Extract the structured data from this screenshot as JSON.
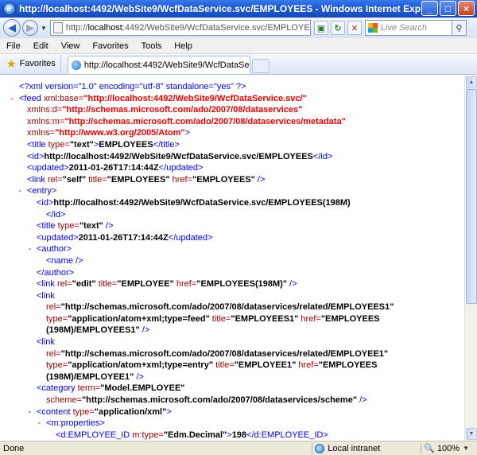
{
  "window": {
    "title": "http://localhost:4492/WebSite9/WcfDataService.svc/EMPLOYEES - Windows Internet Explorer",
    "minimize": "_",
    "maximize": "□",
    "close": "×"
  },
  "address": {
    "url_prefix": "http://",
    "url_host": "localhost",
    "url_path": ":4492/WebSite9/WcfDataService.svc/EMPLOYEES",
    "search_placeholder": "Live Search"
  },
  "menu": [
    "File",
    "Edit",
    "View",
    "Favorites",
    "Tools",
    "Help"
  ],
  "favorites": {
    "label": "Favorites",
    "tab_title": "http://localhost:4492/WebSite9/WcfDataService.svc/..."
  },
  "xml_lines": [
    {
      "indent": 24,
      "parts": [
        {
          "c": "pi",
          "t": "<?xml version=\"1.0\" encoding=\"utf-8\" standalone=\"yes\" ?>"
        }
      ]
    },
    {
      "indent": 24,
      "minus": true,
      "parts": [
        {
          "c": "tg",
          "t": "<feed "
        },
        {
          "c": "an",
          "t": "xml:base="
        },
        {
          "c": "ns",
          "t": "\"http://localhost:4492/WebSite9/WcfDataService.svc/\""
        }
      ]
    },
    {
      "indent": 34,
      "parts": [
        {
          "c": "an",
          "t": "xmlns:d="
        },
        {
          "c": "ns",
          "t": "\"http://schemas.microsoft.com/ado/2007/08/dataservices\""
        }
      ]
    },
    {
      "indent": 34,
      "parts": [
        {
          "c": "an",
          "t": "xmlns:m="
        },
        {
          "c": "ns",
          "t": "\"http://schemas.microsoft.com/ado/2007/08/dataservices/metadata\""
        }
      ]
    },
    {
      "indent": 34,
      "parts": [
        {
          "c": "an",
          "t": "xmlns="
        },
        {
          "c": "ns",
          "t": "\"http://www.w3.org/2005/Atom\""
        },
        {
          "c": "tg",
          "t": ">"
        }
      ]
    },
    {
      "indent": 34,
      "parts": [
        {
          "c": "tg",
          "t": "<title "
        },
        {
          "c": "an",
          "t": "type="
        },
        {
          "c": "av",
          "t": "\"text\""
        },
        {
          "c": "tg",
          "t": ">"
        },
        {
          "c": "tx",
          "t": "EMPLOYEES"
        },
        {
          "c": "tg",
          "t": "</title>"
        }
      ]
    },
    {
      "indent": 34,
      "parts": [
        {
          "c": "tg",
          "t": "<id>"
        },
        {
          "c": "tx",
          "t": "http://localhost:4492/WebSite9/WcfDataService.svc/EMPLOYEES"
        },
        {
          "c": "tg",
          "t": "</id>"
        }
      ]
    },
    {
      "indent": 34,
      "parts": [
        {
          "c": "tg",
          "t": "<updated>"
        },
        {
          "c": "tx",
          "t": "2011-01-26T17:14:44Z"
        },
        {
          "c": "tg",
          "t": "</updated>"
        }
      ]
    },
    {
      "indent": 34,
      "parts": [
        {
          "c": "tg",
          "t": "<link "
        },
        {
          "c": "an",
          "t": "rel="
        },
        {
          "c": "av",
          "t": "\"self\""
        },
        {
          "c": "an",
          "t": " title="
        },
        {
          "c": "av",
          "t": "\"EMPLOYEES\""
        },
        {
          "c": "an",
          "t": " href="
        },
        {
          "c": "av",
          "t": "\"EMPLOYEES\""
        },
        {
          "c": "tg",
          "t": " />"
        }
      ]
    },
    {
      "indent": 34,
      "minus": true,
      "parts": [
        {
          "c": "tg",
          "t": "<entry>"
        }
      ]
    },
    {
      "indent": 46,
      "parts": [
        {
          "c": "tg",
          "t": "<id>"
        },
        {
          "c": "tx",
          "t": "http://localhost:4492/WebSite9/WcfDataService.svc/EMPLOYEES(198M)"
        }
      ]
    },
    {
      "indent": 58,
      "parts": [
        {
          "c": "tg",
          "t": "</id>"
        }
      ]
    },
    {
      "indent": 46,
      "parts": [
        {
          "c": "tg",
          "t": "<title "
        },
        {
          "c": "an",
          "t": "type="
        },
        {
          "c": "av",
          "t": "\"text\""
        },
        {
          "c": "tg",
          "t": " />"
        }
      ]
    },
    {
      "indent": 46,
      "parts": [
        {
          "c": "tg",
          "t": "<updated>"
        },
        {
          "c": "tx",
          "t": "2011-01-26T17:14:44Z"
        },
        {
          "c": "tg",
          "t": "</updated>"
        }
      ]
    },
    {
      "indent": 46,
      "minus": true,
      "parts": [
        {
          "c": "tg",
          "t": "<author>"
        }
      ]
    },
    {
      "indent": 58,
      "parts": [
        {
          "c": "tg",
          "t": "<name />"
        }
      ]
    },
    {
      "indent": 46,
      "parts": [
        {
          "c": "tg",
          "t": "</author>"
        }
      ]
    },
    {
      "indent": 46,
      "parts": [
        {
          "c": "tg",
          "t": "<link "
        },
        {
          "c": "an",
          "t": "rel="
        },
        {
          "c": "av",
          "t": "\"edit\""
        },
        {
          "c": "an",
          "t": " title="
        },
        {
          "c": "av",
          "t": "\"EMPLOYEE\""
        },
        {
          "c": "an",
          "t": " href="
        },
        {
          "c": "av",
          "t": "\"EMPLOYEES(198M)\""
        },
        {
          "c": "tg",
          "t": " />"
        }
      ]
    },
    {
      "indent": 46,
      "parts": [
        {
          "c": "tg",
          "t": "<link"
        }
      ]
    },
    {
      "indent": 58,
      "parts": [
        {
          "c": "an",
          "t": "rel="
        },
        {
          "c": "av",
          "t": "\"http://schemas.microsoft.com/ado/2007/08/dataservices/related/EMPLOYEES1\""
        }
      ]
    },
    {
      "indent": 58,
      "parts": [
        {
          "c": "an",
          "t": "type="
        },
        {
          "c": "av",
          "t": "\"application/atom+xml;type=feed\""
        },
        {
          "c": "an",
          "t": " title="
        },
        {
          "c": "av",
          "t": "\"EMPLOYEES1\""
        },
        {
          "c": "an",
          "t": " href="
        },
        {
          "c": "av",
          "t": "\"EMPLOYEES"
        }
      ]
    },
    {
      "indent": 58,
      "parts": [
        {
          "c": "av",
          "t": "(198M)/EMPLOYEES1\""
        },
        {
          "c": "tg",
          "t": " />"
        }
      ]
    },
    {
      "indent": 46,
      "parts": [
        {
          "c": "tg",
          "t": "<link"
        }
      ]
    },
    {
      "indent": 58,
      "parts": [
        {
          "c": "an",
          "t": "rel="
        },
        {
          "c": "av",
          "t": "\"http://schemas.microsoft.com/ado/2007/08/dataservices/related/EMPLOYEE1\""
        }
      ]
    },
    {
      "indent": 58,
      "parts": [
        {
          "c": "an",
          "t": "type="
        },
        {
          "c": "av",
          "t": "\"application/atom+xml;type=entry\""
        },
        {
          "c": "an",
          "t": " title="
        },
        {
          "c": "av",
          "t": "\"EMPLOYEE1\""
        },
        {
          "c": "an",
          "t": " href="
        },
        {
          "c": "av",
          "t": "\"EMPLOYEES"
        }
      ]
    },
    {
      "indent": 58,
      "parts": [
        {
          "c": "av",
          "t": "(198M)/EMPLOYEE1\""
        },
        {
          "c": "tg",
          "t": " />"
        }
      ]
    },
    {
      "indent": 46,
      "parts": [
        {
          "c": "tg",
          "t": "<category "
        },
        {
          "c": "an",
          "t": "term="
        },
        {
          "c": "av",
          "t": "\"Model.EMPLOYEE\""
        }
      ]
    },
    {
      "indent": 58,
      "parts": [
        {
          "c": "an",
          "t": "scheme="
        },
        {
          "c": "av",
          "t": "\"http://schemas.microsoft.com/ado/2007/08/dataservices/scheme\""
        },
        {
          "c": "tg",
          "t": " />"
        }
      ]
    },
    {
      "indent": 46,
      "minus": true,
      "parts": [
        {
          "c": "tg",
          "t": "<content "
        },
        {
          "c": "an",
          "t": "type="
        },
        {
          "c": "av",
          "t": "\"application/xml\""
        },
        {
          "c": "tg",
          "t": ">"
        }
      ]
    },
    {
      "indent": 58,
      "minus": true,
      "parts": [
        {
          "c": "tg",
          "t": "<m:properties>"
        }
      ]
    },
    {
      "indent": 70,
      "parts": [
        {
          "c": "tg",
          "t": "<d:EMPLOYEE_ID "
        },
        {
          "c": "an",
          "t": "m:type="
        },
        {
          "c": "av",
          "t": "\"Edm.Decimal\""
        },
        {
          "c": "tg",
          "t": ">"
        },
        {
          "c": "tx",
          "t": "198"
        },
        {
          "c": "tg",
          "t": "</d:EMPLOYEE_ID>"
        }
      ]
    }
  ],
  "status": {
    "text": "Done",
    "zone": "Local intranet",
    "zoom": "100%"
  }
}
